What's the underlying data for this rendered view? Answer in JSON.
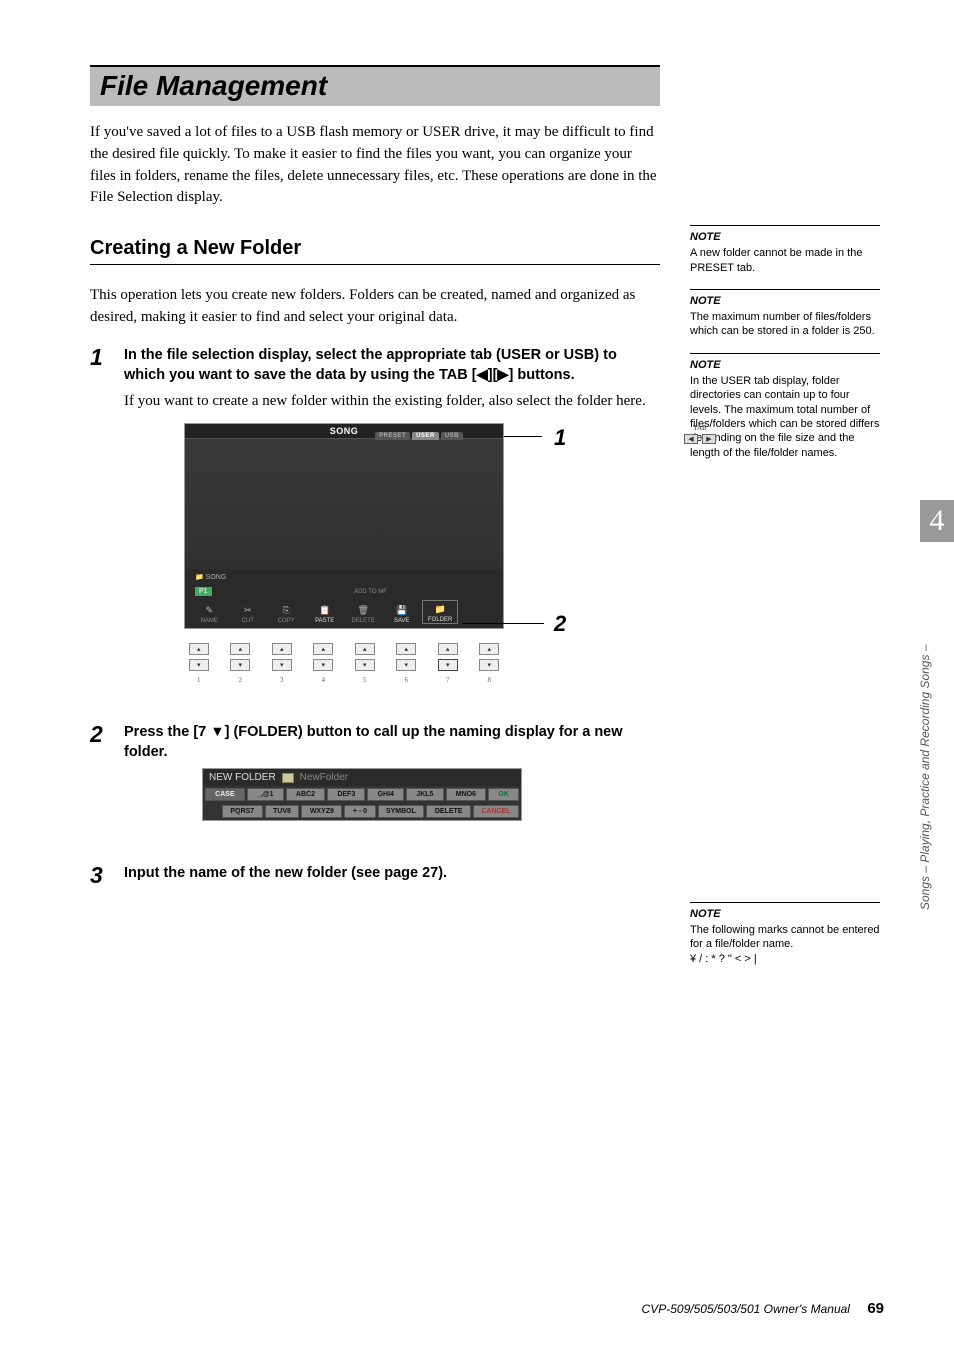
{
  "section_title": "File Management",
  "intro": "If you've saved a lot of files to a USB flash memory or USER drive, it may be difficult to find the desired file quickly. To make it easier to find the files you want, you can organize your files in folders, rename the files, delete unnecessary files, etc. These operations are done in the File Selection display.",
  "subsection_title": "Creating a New Folder",
  "sub_intro": "This operation lets you create new folders. Folders can be created, named and organized as desired, making it easier to find and select your original data.",
  "steps": {
    "s1": {
      "num": "1",
      "bold": "In the file selection display, select the appropriate tab (USER or USB) to which you want to save the data by using the TAB [◀][▶] buttons.",
      "plain": "If you want to create a new folder within the existing folder, also select the folder here."
    },
    "s2": {
      "num": "2",
      "bold": "Press the [7 ▼] (FOLDER) button to call up the naming display for a new folder."
    },
    "s3": {
      "num": "3",
      "bold": "Input the name of the new folder (see page 27)."
    }
  },
  "figure1": {
    "title": "SONG",
    "tabs": [
      "PRESET",
      "USER",
      "USB"
    ],
    "tabctl_label": "TAB",
    "footer_label": "SONG",
    "p1": "P1",
    "cells": [
      "NAME",
      "CUT",
      "COPY",
      "PASTE",
      "DELETE",
      "SAVE",
      "FOLDER",
      ""
    ],
    "addto_label": "ADD TO MF",
    "nums": [
      "1",
      "2",
      "3",
      "4",
      "5",
      "6",
      "7",
      "8"
    ],
    "callout1": "1",
    "callout2": "2"
  },
  "figure2": {
    "header_label": "NEW FOLDER",
    "header_name": "NewFolder",
    "row1": [
      "CASE",
      "_,@1",
      "ABC2",
      "DEF3",
      "GHI4",
      "JKL5",
      "MNO6",
      "OK"
    ],
    "row2": [
      "",
      "PQRS7",
      "TUV8",
      "WXYZ9",
      "+ - 0",
      "SYMBOL",
      "DELETE",
      "CANCEL"
    ]
  },
  "notes": {
    "label": "NOTE",
    "n1": "A new folder cannot be made in the PRESET tab.",
    "n2": "The maximum number of files/folders which can be stored in a folder is 250.",
    "n3": "In the USER tab display, folder directories can contain up to four levels. The maximum total number of files/folders which can be stored differs depending on the file size and the length of the file/folder names.",
    "n4_a": "The following marks cannot be entered for a file/folder name.",
    "n4_b": "¥ / : * ? \" < > |"
  },
  "chapter_num": "4",
  "side_text": "Songs – Playing, Practice and Recording Songs –",
  "footer_manual": "CVP-509/505/503/501 Owner's Manual",
  "footer_page": "69"
}
